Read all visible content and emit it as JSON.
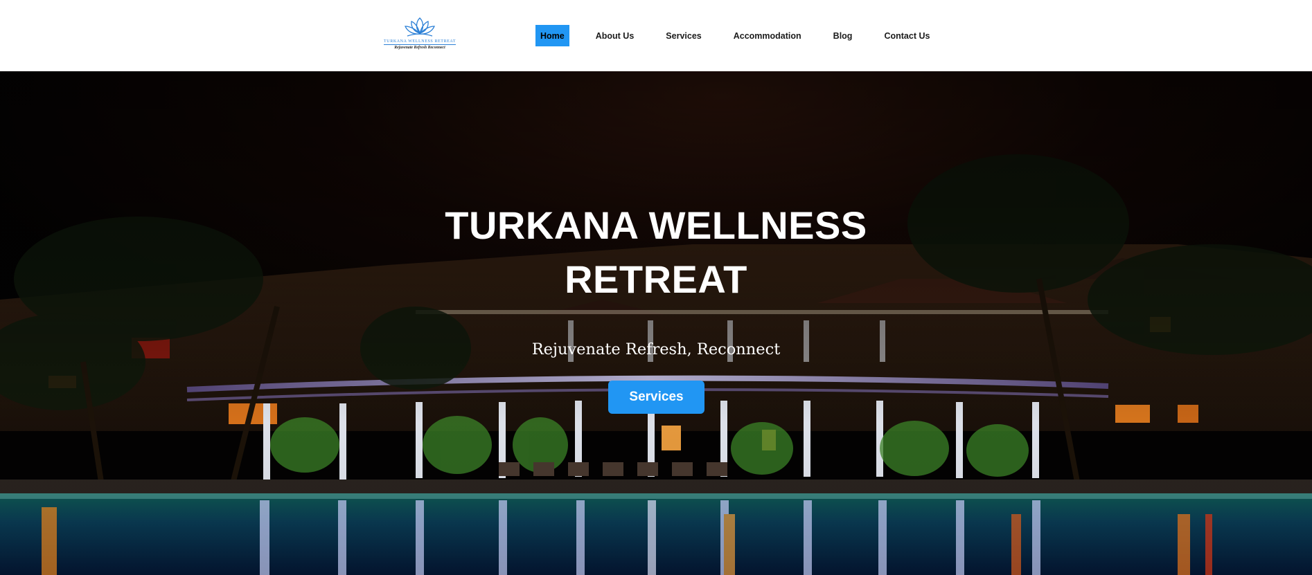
{
  "logo": {
    "name": "TURKANA WELLNESS RETREAT",
    "tagline": "Rejuvenate Refresh Reconnect",
    "icon": "lotus-icon",
    "color": "#2a7fd6"
  },
  "nav": {
    "items": [
      {
        "label": "Home",
        "active": true
      },
      {
        "label": "About Us",
        "active": false
      },
      {
        "label": "Services",
        "active": false
      },
      {
        "label": "Accommodation",
        "active": false
      },
      {
        "label": "Blog",
        "active": false
      },
      {
        "label": "Contact Us",
        "active": false
      }
    ],
    "active_color": "#2196f3"
  },
  "hero": {
    "title_line1": "TURKANA WELLNESS",
    "title_line2": "RETREAT",
    "subtitle": "Rejuvenate Refresh, Reconnect",
    "button_label": "Services",
    "button_color": "#2196f3"
  }
}
